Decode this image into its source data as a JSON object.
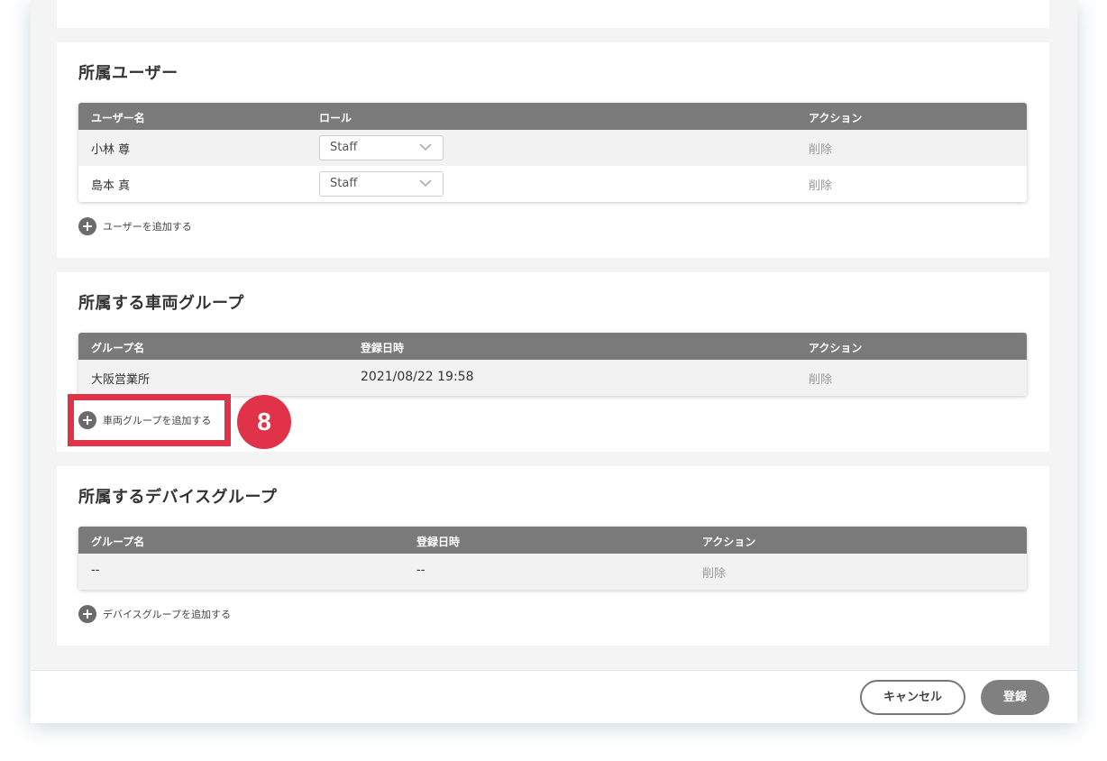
{
  "users_section": {
    "title": "所属ユーザー",
    "columns": [
      "ユーザー名",
      "ロール",
      "アクション"
    ],
    "rows": [
      {
        "name": "小林 尊",
        "role": "Staff",
        "action": "削除"
      },
      {
        "name": "島本 真",
        "role": "Staff",
        "action": "削除"
      }
    ],
    "add_label": "ユーザーを追加する"
  },
  "vehicle_groups_section": {
    "title": "所属する車両グループ",
    "columns": [
      "グループ名",
      "登録日時",
      "アクション"
    ],
    "rows": [
      {
        "name": "大阪営業所",
        "registered": "2021/08/22 19:58",
        "action": "削除"
      }
    ],
    "add_label": "車両グループを追加する"
  },
  "device_groups_section": {
    "title": "所属するデバイスグループ",
    "columns": [
      "グループ名",
      "登録日時",
      "アクション"
    ],
    "rows": [
      {
        "name": "--",
        "registered": "--",
        "action": "削除"
      }
    ],
    "add_label": "デバイスグループを追加する"
  },
  "annotation": {
    "step": "8",
    "color": "#e0334a"
  },
  "footer": {
    "cancel_label": "キャンセル",
    "submit_label": "登録"
  }
}
